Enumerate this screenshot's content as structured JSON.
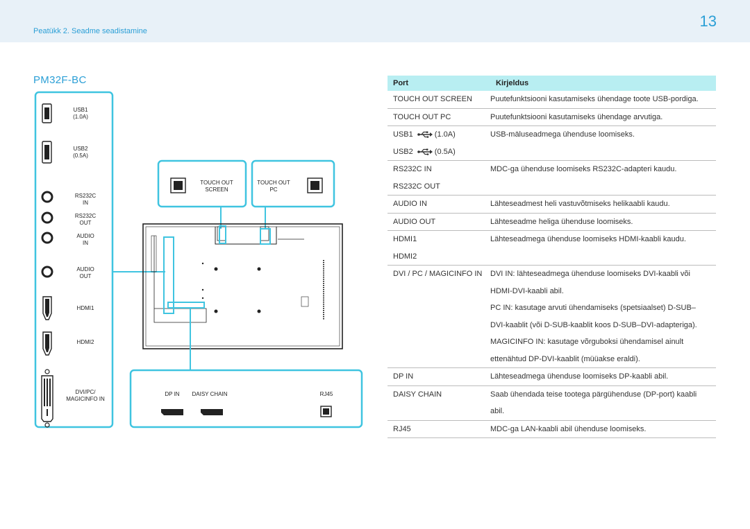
{
  "header": {
    "chapter": "Peatükk 2. Seadme seadistamine",
    "page_number": "13"
  },
  "model": "PM32F-BC",
  "left_panel": {
    "usb1": "USB1",
    "usb1_rating": "(1.0A)",
    "usb2": "USB2",
    "usb2_rating": "(0.5A)",
    "rs232c_in": "RS232C\nIN",
    "rs232c_out": "RS232C\nOUT",
    "audio_in": "AUDIO\nIN",
    "audio_out": "AUDIO\nOUT",
    "hdmi1": "HDMI1",
    "hdmi2": "HDMI2",
    "dvi": "DVI/PC/\nMAGICINFO IN"
  },
  "touch_panel": {
    "screen": "TOUCH OUT\nSCREEN",
    "pc": "TOUCH OUT\nPC"
  },
  "bottom_panel": {
    "dp_in": "DP IN",
    "daisy_chain": "DAISY CHAIN",
    "rj45": "RJ45"
  },
  "table": {
    "col_port": "Port",
    "col_desc": "Kirjeldus",
    "rows": [
      {
        "port": [
          "TOUCH OUT SCREEN"
        ],
        "desc": [
          "Puutefunktsiooni kasutamiseks ühendage toote USB-pordiga."
        ]
      },
      {
        "port": [
          "TOUCH OUT PC"
        ],
        "desc": [
          "Puutefunktsiooni kasutamiseks ühendage arvutiga."
        ]
      },
      {
        "port": [
          "USB1 ",
          "(1.0A)"
        ],
        "port_usb": true,
        "port2": [
          "USB2 ",
          "(0.5A)"
        ],
        "desc": [
          "USB-mäluseadmega ühenduse loomiseks.",
          ""
        ]
      },
      {
        "port": [
          "RS232C IN",
          "RS232C OUT"
        ],
        "desc": [
          "MDC-ga ühenduse loomiseks RS232C-adapteri kaudu.",
          ""
        ]
      },
      {
        "port": [
          "AUDIO IN"
        ],
        "desc": [
          "Lähteseadmest heli vastuvõtmiseks helikaabli kaudu."
        ]
      },
      {
        "port": [
          "AUDIO OUT"
        ],
        "desc": [
          "Lähteseadme heliga ühenduse loomiseks."
        ]
      },
      {
        "port": [
          "HDMI1",
          "HDMI2"
        ],
        "desc": [
          "Lähteseadmega ühenduse loomiseks HDMI-kaabli kaudu.",
          ""
        ]
      },
      {
        "port": [
          "DVI / PC / MAGICINFO IN"
        ],
        "desc": [
          "DVI IN: lähteseadmega ühenduse loomiseks DVI-kaabli või",
          "HDMI-DVI-kaabli abil.",
          "PC IN: kasutage arvuti ühendamiseks (spetsiaalset) D-SUB–",
          "DVI-kaablit (või D-SUB-kaablit koos D-SUB–DVI-adapteriga).",
          "MAGICINFO IN: kasutage võrguboksi ühendamisel ainult",
          "ettenähtud DP-DVI-kaablit (müüakse eraldi)."
        ]
      },
      {
        "port": [
          "DP IN"
        ],
        "desc": [
          "Lähteseadmega ühenduse loomiseks DP-kaabli abil."
        ]
      },
      {
        "port": [
          "DAISY CHAIN"
        ],
        "desc": [
          "Saab ühendada teise tootega pärgühenduse (DP-port) kaabli",
          "abil."
        ]
      },
      {
        "port": [
          "RJ45"
        ],
        "desc": [
          "MDC-ga LAN-kaabli abil ühenduse loomiseks."
        ]
      }
    ]
  },
  "colors": {
    "accent": "#2b9fd6",
    "highlight": "#3fc4e0",
    "table_header": "#b8eef2"
  }
}
